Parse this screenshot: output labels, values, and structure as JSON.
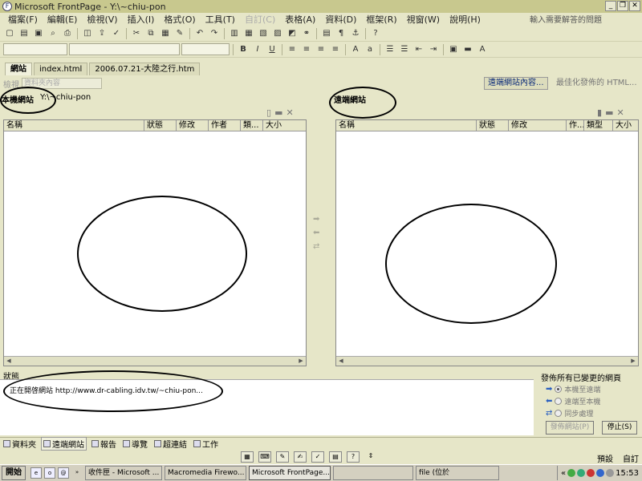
{
  "window": {
    "title": "Microsoft FrontPage - Y:\\~chiu-pon",
    "min_label": "_",
    "max_label": "❐",
    "close_label": "✕"
  },
  "menubar": {
    "items": [
      "檔案(F)",
      "編輯(E)",
      "檢視(V)",
      "插入(I)",
      "格式(O)",
      "工具(T)",
      "自訂(C)",
      "表格(A)",
      "資料(D)",
      "框架(R)",
      "視窗(W)",
      "說明(H)"
    ],
    "help_placeholder": "輸入需要解答的問題"
  },
  "doc_tabs": [
    "網站",
    "index.html",
    "2006.07.21-大陸之行.htm"
  ],
  "viewbar": {
    "view_label": "檢視",
    "view_value": "資料夾內容",
    "remote_btn": "遠端網站內容...",
    "optimize_btn": "最佳化發佈的 HTML..."
  },
  "local_pane": {
    "title": "本機網站",
    "path": "Y:\\~chiu-pon",
    "columns": [
      "名稱",
      "狀態",
      "修改",
      "作者",
      "類...",
      "大小"
    ]
  },
  "remote_pane": {
    "title": "遠端網站",
    "columns": [
      "名稱",
      "狀態",
      "修改",
      "作...",
      "類型",
      "大小"
    ]
  },
  "status": {
    "label": "狀態",
    "text": "正在開啓網站 http://www.dr-cabling.idv.tw/~chiu-pon..."
  },
  "publish": {
    "title": "發佈所有已變更的網頁",
    "options": [
      "本機至遠端",
      "遠端至本機",
      "同步處理"
    ],
    "publish_btn": "發佈網站(P)",
    "stop_btn": "停止(S)"
  },
  "view_tabs": [
    "資料夾",
    "遠端網站",
    "報告",
    "導覽",
    "超連結",
    "工作"
  ],
  "statusbar": {
    "right1": "預設",
    "right2": "自訂"
  },
  "taskbar": {
    "start": "開始",
    "tasks": [
      "收件匣 - Microsoft ...",
      "Macromedia Firewo...",
      "Microsoft FrontPage...",
      "",
      "file (位於"
    ],
    "clock": "15:53"
  }
}
